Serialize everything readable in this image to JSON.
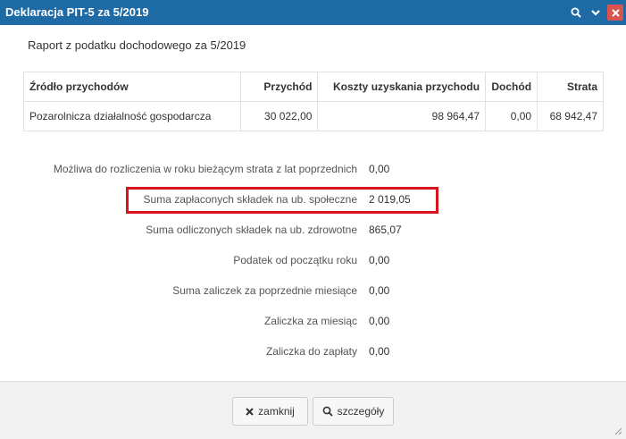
{
  "window": {
    "title": "Deklaracja PIT-5 za 5/2019",
    "controls": {
      "search_icon": "search-icon",
      "collapse_icon": "chevron-down-icon",
      "close_icon": "close-icon"
    }
  },
  "report": {
    "title": "Raport z podatku dochodowego za 5/2019"
  },
  "income_table": {
    "headers": [
      "Źródło przychodów",
      "Przychód",
      "Koszty uzyskania przychodu",
      "Dochód",
      "Strata"
    ],
    "rows": [
      [
        "Pozarolnicza działalność gospodarcza",
        "30 022,00",
        "98 964,47",
        "0,00",
        "68 942,47"
      ]
    ]
  },
  "summary": [
    {
      "label": "Możliwa do rozliczenia w roku bieżącym strata z lat poprzednich",
      "value": "0,00"
    },
    {
      "label": "Suma zapłaconych składek na ub. społeczne",
      "value": "2 019,05",
      "highlighted": true
    },
    {
      "label": "Suma odliczonych składek na ub. zdrowotne",
      "value": "865,07"
    },
    {
      "label": "Podatek od początku roku",
      "value": "0,00"
    },
    {
      "label": "Suma zaliczek za poprzednie miesiące",
      "value": "0,00"
    },
    {
      "label": "Zaliczka za miesiąc",
      "value": "0,00"
    },
    {
      "label": "Zaliczka do zapłaty",
      "value": "0,00"
    }
  ],
  "footer": {
    "close_label": "zamknij",
    "details_label": "szczegóły"
  },
  "colors": {
    "titlebar": "#1e6aa5",
    "close_button": "#d9534f",
    "highlight": "#d9141e"
  }
}
